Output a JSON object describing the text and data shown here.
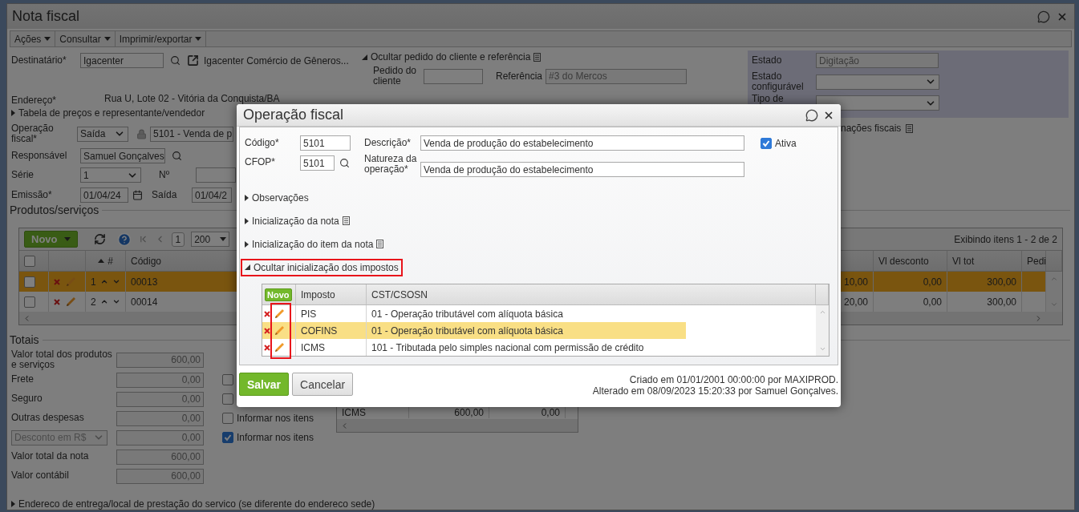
{
  "window": {
    "title": "Nota fiscal"
  },
  "menu": [
    {
      "label": "Ações"
    },
    {
      "label": "Consultar"
    },
    {
      "label": "Imprimir/exportar"
    }
  ],
  "header_form": {
    "destinatario": {
      "label": "Destinatário*",
      "value": "Igacenter",
      "name": "Igacenter Comércio de Gêneros..."
    },
    "pedido_section": {
      "toggle": "Ocultar pedido do cliente e referência",
      "expanded": true,
      "pedido_label": "Pedido do cliente",
      "referencia_label": "Referência",
      "referencia_value": "#3 do Mercos"
    },
    "endereco": {
      "label": "Endereço*",
      "value": "Rua U, Lote 02 - Vitória da Conquista/BA"
    },
    "tabela_toggle": {
      "label": "Tabela de preços e representante/vendedor",
      "expanded": false
    },
    "operacao": {
      "label": "Operação fiscal*",
      "type": "Saída",
      "value": "5101 - Venda de p"
    },
    "responsavel": {
      "label": "Responsável",
      "value": "Samuel Gonçalves"
    },
    "serie": {
      "label": "Série",
      "value": "1",
      "numero_label": "Nº"
    },
    "emissao": {
      "label": "Emissão*",
      "value": "01/04/24",
      "saida_label": "Saída",
      "saida_value": "01/04/2"
    }
  },
  "status_panel": {
    "estado_label": "Estado",
    "estado_value": "Digitação",
    "estado_config_label": "Estado configurável",
    "tipo_label": "Tipo de"
  },
  "fiscal_info_link": "nações fiscais",
  "products": {
    "legend": "Produtos/serviços",
    "new_button": "Novo",
    "header_checked": false,
    "page": "1",
    "page_size": "200",
    "summary": "Exibindo itens 1 - 2 de 2",
    "columns": {
      "index": "#",
      "code": "Código",
      "discount": "Vl desconto",
      "total": "Vl tot",
      "order": "Pedi"
    },
    "rows": [
      {
        "index": "1",
        "code": "00013",
        "column_5": "10,00",
        "discount": "0,00",
        "total": "300,00",
        "selected": true,
        "checked": false
      },
      {
        "index": "2",
        "code": "00014",
        "column_5": "20,00",
        "discount": "0,00",
        "total": "300,00",
        "selected": false,
        "checked": false
      }
    ]
  },
  "totals": {
    "legend": "Totais",
    "rows": [
      {
        "kind": "label",
        "label": "Valor total dos produtos e serviços",
        "value": "600,00"
      },
      {
        "kind": "label",
        "label": "Frete",
        "value": "0,00",
        "checkbox": {
          "checked": false
        }
      },
      {
        "kind": "label",
        "label": "Seguro",
        "value": "0,00",
        "checkbox": {
          "checked": false
        }
      },
      {
        "kind": "label",
        "label": "Outras despesas",
        "value": "0,00",
        "checkbox": {
          "label": "Informar nos itens",
          "checked": false
        }
      },
      {
        "kind": "select",
        "label": "Desconto em R$",
        "value": "0,00",
        "checkbox": {
          "label": "Informar nos itens",
          "checked": true
        }
      },
      {
        "kind": "label",
        "label": "Valor total da nota",
        "value": "600,00"
      },
      {
        "kind": "label",
        "label": "Valor contábil",
        "value": "600,00"
      }
    ],
    "tax_summary": [
      {
        "tax": "ICMS",
        "base": "600,00",
        "value": "0,00"
      }
    ]
  },
  "delivery_toggle": {
    "label": "Endereco de entrega/local de prestação do servico (se diferente do endereco sede)",
    "expanded": false
  },
  "dialog": {
    "title": "Operação fiscal",
    "codigo": {
      "label": "Código*",
      "value": "5101"
    },
    "descricao": {
      "label": "Descrição*",
      "value": "Venda de produção do estabelecimento"
    },
    "ativa": {
      "label": "Ativa",
      "checked": true
    },
    "cfop": {
      "label": "CFOP*",
      "value": "5101"
    },
    "natureza": {
      "label": "Natureza da operação*",
      "value": "Venda de produção do estabelecimento"
    },
    "sections": [
      {
        "label": "Observações",
        "expanded": false,
        "doc_icon": false,
        "highlighted": false
      },
      {
        "label": "Inicialização da nota",
        "expanded": false,
        "doc_icon": true,
        "highlighted": false
      },
      {
        "label": "Inicialização do item da nota",
        "expanded": false,
        "doc_icon": true,
        "highlighted": false
      },
      {
        "label": "Ocultar inicialização dos impostos",
        "expanded": true,
        "doc_icon": false,
        "highlighted": true
      }
    ],
    "taxes": {
      "new_button": "Novo",
      "columns": {
        "tax": "Imposto",
        "cst": "CST/CSOSN"
      },
      "edit_column_highlighted": true,
      "rows": [
        {
          "tax": "PIS",
          "cst": "01 - Operação tributável com alíquota básica",
          "selected": false
        },
        {
          "tax": "COFINS",
          "cst": "01 - Operação tributável com alíquota básica",
          "selected": true
        },
        {
          "tax": "ICMS",
          "cst": "101 - Tributada pelo simples nacional com permissão de crédito",
          "selected": false
        }
      ]
    },
    "buttons": [
      {
        "label": "Salvar",
        "kind": "primary"
      },
      {
        "label": "Cancelar",
        "kind": "secondary"
      }
    ],
    "audit": [
      "Criado em 01/01/2001 00:00:00 por MAXIPROD.",
      "Alterado em 08/09/2023 15:20:33 por Samuel Gonçalves."
    ]
  }
}
